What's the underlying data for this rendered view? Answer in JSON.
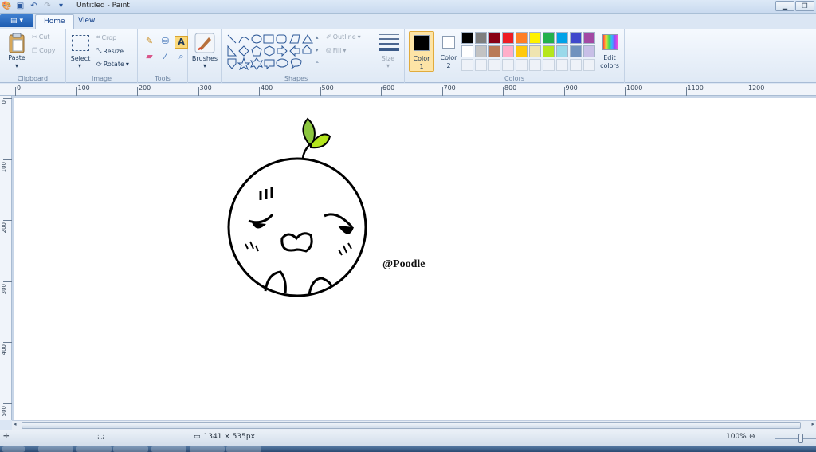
{
  "window": {
    "title": "Untitled - Paint"
  },
  "tabs": {
    "home": "Home",
    "view": "View"
  },
  "ribbon": {
    "clipboard": {
      "paste": "Paste",
      "cut": "Cut",
      "copy": "Copy",
      "label": "Clipboard"
    },
    "image": {
      "select": "Select",
      "crop": "Crop",
      "resize": "Resize",
      "rotate": "Rotate",
      "label": "Image"
    },
    "tools": {
      "label": "Tools"
    },
    "brushes": {
      "label": "Brushes"
    },
    "shapes": {
      "outline": "Outline",
      "fill": "Fill",
      "label": "Shapes"
    },
    "size": {
      "label": "Size"
    },
    "colors": {
      "color1": "Color",
      "color1_num": "1",
      "color2": "Color",
      "color2_num": "2",
      "edit": "Edit",
      "edit2": "colors",
      "label": "Colors",
      "color1_value": "#000000",
      "color2_value": "#ffffff",
      "palette_row1": [
        "#000000",
        "#7f7f7f",
        "#880015",
        "#ed1c24",
        "#ff7f27",
        "#fff200",
        "#22b14c",
        "#00a2e8",
        "#3f48cc",
        "#a349a4"
      ],
      "palette_row2": [
        "#ffffff",
        "#c3c3c3",
        "#b97a57",
        "#ffaec9",
        "#ffc90e",
        "#efe4b0",
        "#b5e61d",
        "#99d9ea",
        "#7092be",
        "#c8bfe7"
      ]
    }
  },
  "ruler": {
    "top": [
      "0",
      "100",
      "200",
      "300",
      "400",
      "500",
      "600",
      "700",
      "800",
      "900",
      "1000",
      "1100",
      "1200"
    ],
    "left": [
      "0",
      "100",
      "200",
      "300",
      "400",
      "500"
    ]
  },
  "canvas": {
    "signature": "@Poodle"
  },
  "status": {
    "dimensions": "1341 × 535px",
    "zoom": "100%"
  }
}
